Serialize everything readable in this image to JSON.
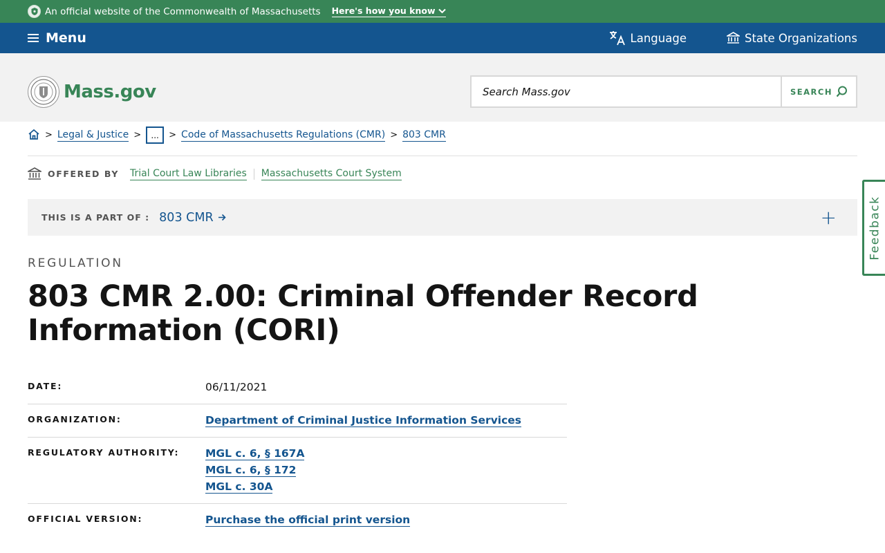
{
  "official_banner": {
    "text": "An official website of the Commonwealth of Massachusetts",
    "how_you_know": "Here's how you know"
  },
  "utility_nav": {
    "menu_label": "Menu",
    "language_label": "Language",
    "state_orgs_label": "State Organizations"
  },
  "header": {
    "logo_text": "Mass.gov",
    "search_placeholder": "Search Mass.gov",
    "search_button": "SEARCH"
  },
  "breadcrumb": {
    "items": [
      "Legal & Justice",
      "...",
      "Code of Massachusetts Regulations (CMR)",
      "803 CMR"
    ]
  },
  "offered_by": {
    "label": "OFFERED BY",
    "orgs": [
      "Trial Court Law Libraries",
      "Massachusetts Court System"
    ]
  },
  "part_of": {
    "label": "THIS IS A PART OF :",
    "link": "803 CMR",
    "toggle": "+"
  },
  "feedback": {
    "label": "Feedback"
  },
  "page": {
    "category": "REGULATION",
    "title": "803 CMR 2.00: Criminal Offender Record Information (CORI)"
  },
  "meta": {
    "date_label": "DATE:",
    "date_value": "06/11/2021",
    "org_label": "ORGANIZATION:",
    "org_value": "Department of Criminal Justice Information Services",
    "authority_label": "REGULATORY AUTHORITY:",
    "authority_links": [
      "MGL c. 6, § 167A",
      "MGL c. 6, § 172",
      "MGL c. 30A"
    ],
    "version_label": "OFFICIAL VERSION:",
    "version_value": "Purchase the official print version"
  },
  "colors": {
    "green": "#388557",
    "blue": "#14558f",
    "header_bg": "#f2f2f2"
  }
}
